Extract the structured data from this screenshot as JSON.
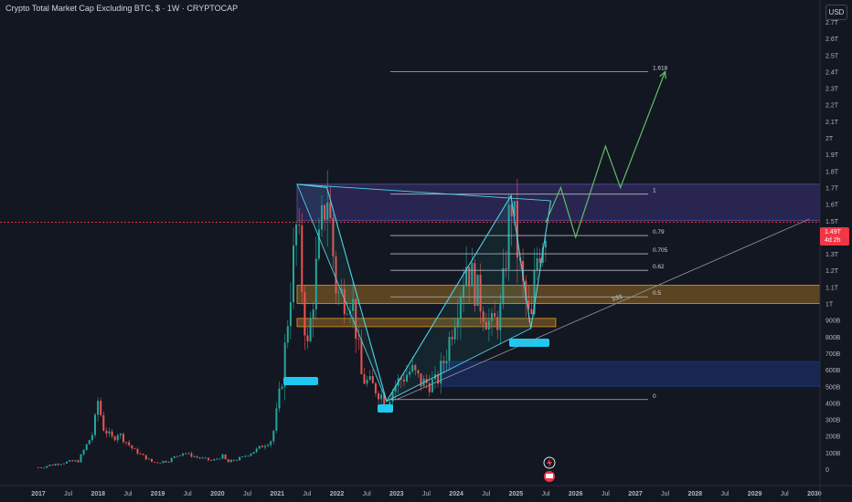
{
  "header": {
    "title": "Crypto Total Market Cap Excluding BTC, $ · 1W · CRYPTOCAP",
    "currency_button": "USD"
  },
  "price_tag": {
    "price": "1.49T",
    "countdown": "4d 2h"
  },
  "fib_labels": [
    "1.618",
    "1",
    "0.79",
    "0.705",
    "0.62",
    "0.5",
    "0"
  ],
  "annotation": "$$$",
  "colors": {
    "background": "#131722",
    "candle_up": "#26a69a",
    "candle_down": "#ef5350",
    "pattern_line": "#4dd0e1",
    "projection_line": "#66bb6a",
    "zone_yellow": "#f5a623",
    "zone_blue": "#2962ff",
    "zone_purple": "#7b61ff",
    "price_line": "#f23645"
  },
  "icons": [
    "lightning-icon",
    "flag-icon"
  ],
  "chart_data": {
    "type": "candlestick",
    "title": "Crypto Total Market Cap Excluding BTC, $ · 1W · CRYPTOCAP",
    "y_ticks": [
      "2.7T",
      "2.6T",
      "2.5T",
      "2.4T",
      "2.3T",
      "2.2T",
      "2.1T",
      "2T",
      "1.9T",
      "1.8T",
      "1.7T",
      "1.6T",
      "1.5T",
      "1.4T",
      "1.3T",
      "1.2T",
      "1.1T",
      "1T",
      "900B",
      "800B",
      "700B",
      "600B",
      "500B",
      "400B",
      "300B",
      "200B",
      "100B",
      "0"
    ],
    "x_ticks": [
      "2017",
      "Jul",
      "2018",
      "Jul",
      "2019",
      "Jul",
      "2020",
      "Jul",
      "2021",
      "Jul",
      "2022",
      "Jul",
      "2023",
      "Jul",
      "2024",
      "Jul",
      "2025",
      "Jul",
      "2026",
      "Jul",
      "2027",
      "Jul",
      "2028",
      "Jul",
      "2029",
      "Jul",
      "2030"
    ],
    "ylim": [
      0,
      2700000000000
    ],
    "last_price": "1.49T",
    "price_path": [
      [
        "2017-01",
        0.01
      ],
      [
        "2017-06",
        0.04
      ],
      [
        "2017-09",
        0.05
      ],
      [
        "2017-12",
        0.22
      ],
      [
        "2018-01",
        0.42
      ],
      [
        "2018-02",
        0.25
      ],
      [
        "2018-04",
        0.18
      ],
      [
        "2018-05",
        0.22
      ],
      [
        "2018-08",
        0.12
      ],
      [
        "2018-12",
        0.04
      ],
      [
        "2019-03",
        0.05
      ],
      [
        "2019-06",
        0.1
      ],
      [
        "2019-09",
        0.07
      ],
      [
        "2019-12",
        0.05
      ],
      [
        "2020-02",
        0.08
      ],
      [
        "2020-03",
        0.04
      ],
      [
        "2020-06",
        0.07
      ],
      [
        "2020-09",
        0.12
      ],
      [
        "2020-12",
        0.18
      ],
      [
        "2021-02",
        0.55
      ],
      [
        "2021-05",
        1.5
      ],
      [
        "2021-07",
        0.7
      ],
      [
        "2021-09",
        1.25
      ],
      [
        "2021-11",
        1.7
      ],
      [
        "2022-01",
        1.05
      ],
      [
        "2022-04",
        1.05
      ],
      [
        "2022-06",
        0.55
      ],
      [
        "2022-09",
        0.48
      ],
      [
        "2022-11",
        0.41
      ],
      [
        "2023-01",
        0.52
      ],
      [
        "2023-04",
        0.6
      ],
      [
        "2023-06",
        0.52
      ],
      [
        "2023-09",
        0.52
      ],
      [
        "2023-11",
        0.7
      ],
      [
        "2024-03",
        1.25
      ],
      [
        "2024-05",
        1.08
      ],
      [
        "2024-08",
        0.85
      ],
      [
        "2024-10",
        0.95
      ],
      [
        "2024-12",
        1.65
      ],
      [
        "2025-02",
        1.15
      ],
      [
        "2025-04",
        0.85
      ],
      [
        "2025-05",
        1.25
      ],
      [
        "2025-07",
        1.49
      ]
    ],
    "fib_levels": [
      {
        "label": "1.618",
        "value": 2.4
      },
      {
        "label": "1",
        "value": 1.66
      },
      {
        "label": "0.79",
        "value": 1.41
      },
      {
        "label": "0.705",
        "value": 1.3
      },
      {
        "label": "0.62",
        "value": 1.2
      },
      {
        "label": "0.5",
        "value": 1.04
      },
      {
        "label": "0",
        "value": 0.42
      }
    ],
    "projection_path": [
      [
        "2025-07",
        1.49
      ],
      [
        "2025-10",
        1.7
      ],
      [
        "2026-01",
        1.4
      ],
      [
        "2026-07",
        1.95
      ],
      [
        "2026-10",
        1.7
      ],
      [
        "2027-07",
        2.4
      ]
    ],
    "zones": [
      {
        "name": "resistance",
        "color": "purple",
        "from": "2021-05",
        "to": "2030-12",
        "low": 1.5,
        "high": 1.72
      },
      {
        "name": "support-1",
        "color": "yellow",
        "from": "2021-05",
        "to": "2030-12",
        "low": 1.0,
        "high": 1.11
      },
      {
        "name": "support-2",
        "color": "yellow",
        "from": "2021-05",
        "to": "2025-09",
        "low": 0.86,
        "high": 0.91
      },
      {
        "name": "demand",
        "color": "blue",
        "from": "2023-10",
        "to": "2030-12",
        "low": 0.5,
        "high": 0.65
      }
    ],
    "trendline": [
      [
        "2023-01",
        0.42
      ],
      [
        "2029-12",
        1.51
      ]
    ],
    "pattern_points": [
      [
        "2021-05",
        1.72
      ],
      [
        "2021-11",
        1.7
      ],
      [
        "2022-11",
        0.41
      ],
      [
        "2024-12",
        1.65
      ],
      [
        "2025-04",
        0.85
      ],
      [
        "2025-08",
        1.62
      ]
    ],
    "current_price_line": 1.49
  }
}
